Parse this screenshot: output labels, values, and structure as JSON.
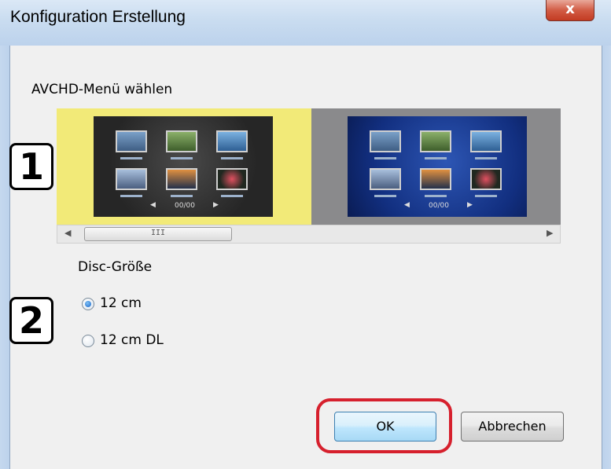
{
  "window": {
    "title": "Konfiguration Erstellung",
    "close_glyph": "x"
  },
  "menu_section": {
    "label": "AVCHD-Menü wählen",
    "options": [
      {
        "style": "dark-hexagon",
        "selected": true,
        "highlight_color": "#f2ea78"
      },
      {
        "style": "blue-wave",
        "selected": false
      }
    ],
    "thumbnail_page": "00/00",
    "scrollbar": {
      "left_arrow": "◀",
      "right_arrow": "▶",
      "grip": "III"
    }
  },
  "disc_size": {
    "label": "Disc-Größe",
    "options": [
      {
        "label": "12 cm",
        "checked": true
      },
      {
        "label": "12 cm DL",
        "checked": false
      }
    ]
  },
  "badges": {
    "step1": "1",
    "step2": "2"
  },
  "buttons": {
    "ok": "OK",
    "cancel": "Abbrechen"
  },
  "colors": {
    "selection": "#f2ea78",
    "ok_highlight": "#d6202d"
  }
}
